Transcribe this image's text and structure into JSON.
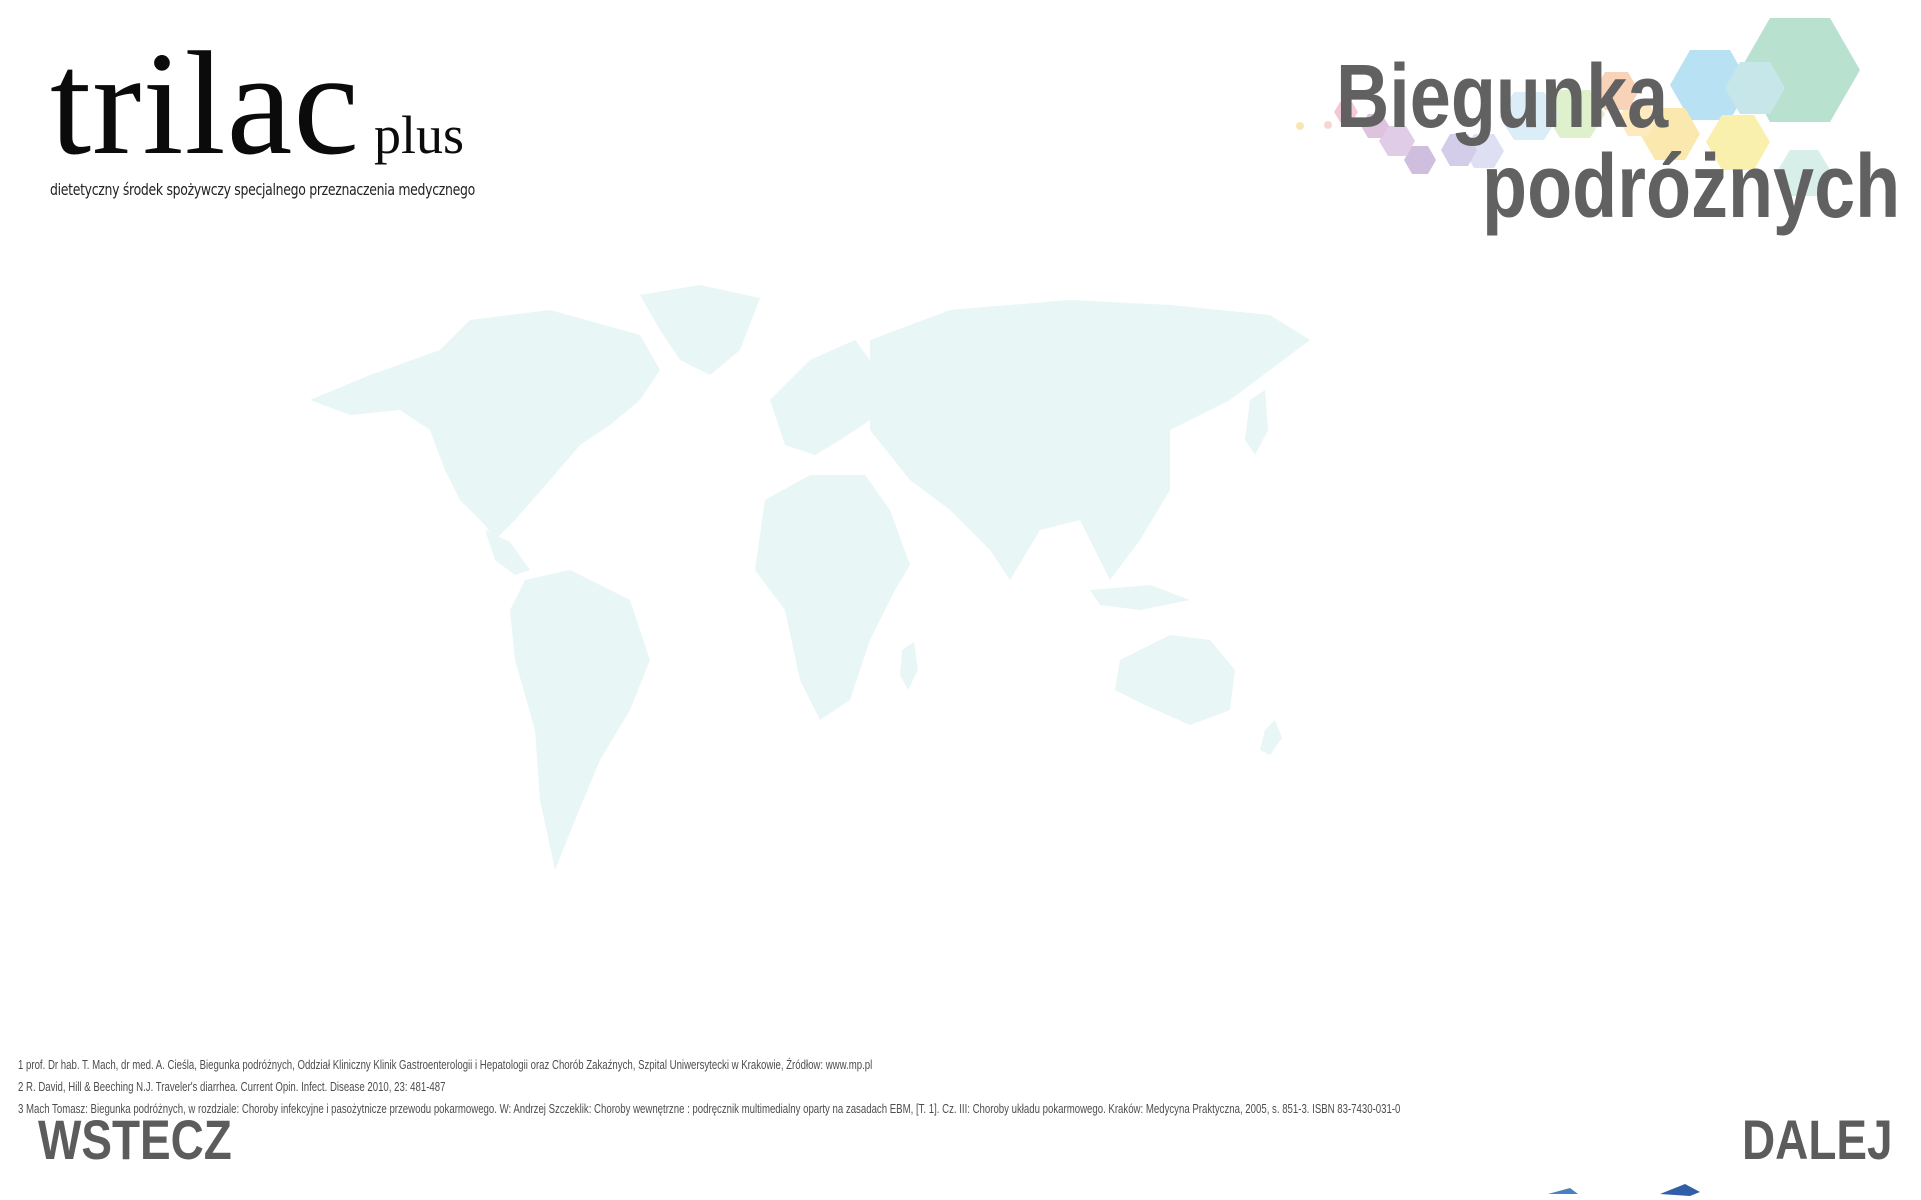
{
  "brand": {
    "name": "trilac",
    "suffix": "plus",
    "tagline": "dietetyczny środek spożywczy specjalnego przeznaczenia medycznego"
  },
  "hero": {
    "line1": "Biegunka",
    "line2": "podróżnych",
    "text_color": "#616161"
  },
  "map": {
    "fill_color": "#e8f6f6"
  },
  "footnotes": [
    "1 prof. Dr hab. T. Mach, dr med. A. Cieśla, Biegunka podróżnych, Oddział Kliniczny Klinik Gastroenterologii i Hepatologii oraz Chorób Zakaźnych, Szpital Uniwersytecki w Krakowie, Źródłow: www.mp.pl",
    "2 R. David, Hill & Beeching N.J. Traveler's diarrhea. Current Opin. Infect. Disease 2010, 23: 481-487",
    "3 Mach Tomasz: Biegunka podróżnych, w rozdziale: Choroby infekcyjne i pasożytnicze przewodu pokarmowego. W: Andrzej Szczeklik: Choroby wewnętrzne : podręcznik multimedialny oparty na zasadach EBM, [T. 1]. Cz. III: Choroby układu pokarmowego. Kraków: Medycyna Praktyczna, 2005, s. 851-3. ISBN 83-7430-031-0"
  ],
  "nav": {
    "prev": "WSTECZ",
    "next": "DALEJ"
  }
}
